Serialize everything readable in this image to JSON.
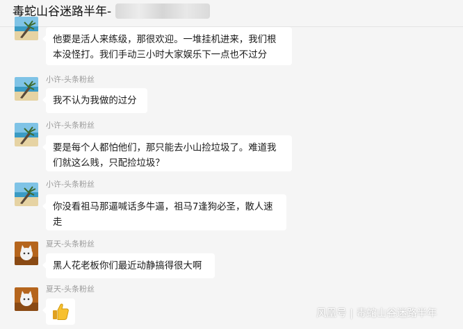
{
  "header": {
    "title": "毒蛇山谷迷路半年-"
  },
  "messages": [
    {
      "sender": "",
      "lines": [
        "他要是活人来练级，那很欢迎。一堆挂机进来，我们根",
        "本没怪打。我们手动三小时大家娱乐下一点也不过分"
      ],
      "avatar": "beach"
    },
    {
      "sender": "小许-头条粉丝",
      "lines": [
        "我不认为我做的过分"
      ],
      "avatar": "beach"
    },
    {
      "sender": "小许-头条粉丝",
      "lines": [
        "要是每个人都怕他们，那只能去小山捡垃圾了。难道我",
        "们就这么贱，只配捡垃圾？"
      ],
      "avatar": "beach"
    },
    {
      "sender": "小许-头条粉丝",
      "lines": [
        "你没看祖马那逼喊话多牛逼，祖马7逢狗必圣，散人速",
        "走"
      ],
      "avatar": "beach"
    },
    {
      "sender": "夏天-头条粉丝",
      "lines": [
        "黑人花老板你们最近动静搞得很大啊"
      ],
      "avatar": "cat"
    },
    {
      "sender": "夏天-头条粉丝",
      "lines": [],
      "avatar": "cat",
      "icon": "thumbs-up-icon"
    }
  ],
  "watermark": "风凰号 | 毒蛇山谷迷路半年"
}
